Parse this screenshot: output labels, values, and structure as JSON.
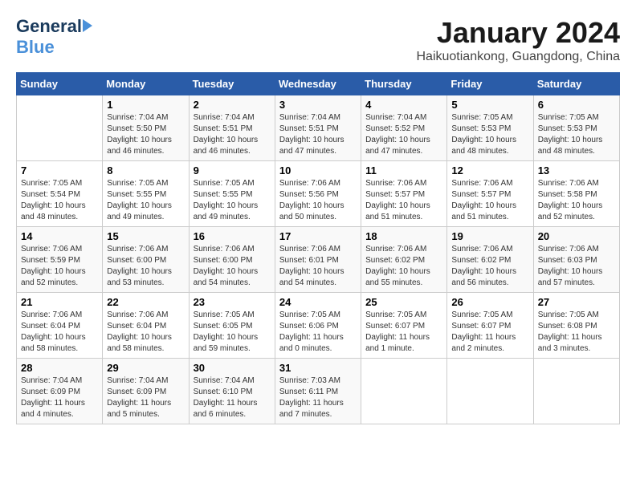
{
  "logo": {
    "part1": "General",
    "part2": "Blue"
  },
  "title": "January 2024",
  "location": "Haikuotiankong, Guangdong, China",
  "headers": [
    "Sunday",
    "Monday",
    "Tuesday",
    "Wednesday",
    "Thursday",
    "Friday",
    "Saturday"
  ],
  "weeks": [
    [
      {
        "day": "",
        "sunrise": "",
        "sunset": "",
        "daylight": ""
      },
      {
        "day": "1",
        "sunrise": "Sunrise: 7:04 AM",
        "sunset": "Sunset: 5:50 PM",
        "daylight": "Daylight: 10 hours and 46 minutes."
      },
      {
        "day": "2",
        "sunrise": "Sunrise: 7:04 AM",
        "sunset": "Sunset: 5:51 PM",
        "daylight": "Daylight: 10 hours and 46 minutes."
      },
      {
        "day": "3",
        "sunrise": "Sunrise: 7:04 AM",
        "sunset": "Sunset: 5:51 PM",
        "daylight": "Daylight: 10 hours and 47 minutes."
      },
      {
        "day": "4",
        "sunrise": "Sunrise: 7:04 AM",
        "sunset": "Sunset: 5:52 PM",
        "daylight": "Daylight: 10 hours and 47 minutes."
      },
      {
        "day": "5",
        "sunrise": "Sunrise: 7:05 AM",
        "sunset": "Sunset: 5:53 PM",
        "daylight": "Daylight: 10 hours and 48 minutes."
      },
      {
        "day": "6",
        "sunrise": "Sunrise: 7:05 AM",
        "sunset": "Sunset: 5:53 PM",
        "daylight": "Daylight: 10 hours and 48 minutes."
      }
    ],
    [
      {
        "day": "7",
        "sunrise": "Sunrise: 7:05 AM",
        "sunset": "Sunset: 5:54 PM",
        "daylight": "Daylight: 10 hours and 48 minutes."
      },
      {
        "day": "8",
        "sunrise": "Sunrise: 7:05 AM",
        "sunset": "Sunset: 5:55 PM",
        "daylight": "Daylight: 10 hours and 49 minutes."
      },
      {
        "day": "9",
        "sunrise": "Sunrise: 7:05 AM",
        "sunset": "Sunset: 5:55 PM",
        "daylight": "Daylight: 10 hours and 49 minutes."
      },
      {
        "day": "10",
        "sunrise": "Sunrise: 7:06 AM",
        "sunset": "Sunset: 5:56 PM",
        "daylight": "Daylight: 10 hours and 50 minutes."
      },
      {
        "day": "11",
        "sunrise": "Sunrise: 7:06 AM",
        "sunset": "Sunset: 5:57 PM",
        "daylight": "Daylight: 10 hours and 51 minutes."
      },
      {
        "day": "12",
        "sunrise": "Sunrise: 7:06 AM",
        "sunset": "Sunset: 5:57 PM",
        "daylight": "Daylight: 10 hours and 51 minutes."
      },
      {
        "day": "13",
        "sunrise": "Sunrise: 7:06 AM",
        "sunset": "Sunset: 5:58 PM",
        "daylight": "Daylight: 10 hours and 52 minutes."
      }
    ],
    [
      {
        "day": "14",
        "sunrise": "Sunrise: 7:06 AM",
        "sunset": "Sunset: 5:59 PM",
        "daylight": "Daylight: 10 hours and 52 minutes."
      },
      {
        "day": "15",
        "sunrise": "Sunrise: 7:06 AM",
        "sunset": "Sunset: 6:00 PM",
        "daylight": "Daylight: 10 hours and 53 minutes."
      },
      {
        "day": "16",
        "sunrise": "Sunrise: 7:06 AM",
        "sunset": "Sunset: 6:00 PM",
        "daylight": "Daylight: 10 hours and 54 minutes."
      },
      {
        "day": "17",
        "sunrise": "Sunrise: 7:06 AM",
        "sunset": "Sunset: 6:01 PM",
        "daylight": "Daylight: 10 hours and 54 minutes."
      },
      {
        "day": "18",
        "sunrise": "Sunrise: 7:06 AM",
        "sunset": "Sunset: 6:02 PM",
        "daylight": "Daylight: 10 hours and 55 minutes."
      },
      {
        "day": "19",
        "sunrise": "Sunrise: 7:06 AM",
        "sunset": "Sunset: 6:02 PM",
        "daylight": "Daylight: 10 hours and 56 minutes."
      },
      {
        "day": "20",
        "sunrise": "Sunrise: 7:06 AM",
        "sunset": "Sunset: 6:03 PM",
        "daylight": "Daylight: 10 hours and 57 minutes."
      }
    ],
    [
      {
        "day": "21",
        "sunrise": "Sunrise: 7:06 AM",
        "sunset": "Sunset: 6:04 PM",
        "daylight": "Daylight: 10 hours and 58 minutes."
      },
      {
        "day": "22",
        "sunrise": "Sunrise: 7:06 AM",
        "sunset": "Sunset: 6:04 PM",
        "daylight": "Daylight: 10 hours and 58 minutes."
      },
      {
        "day": "23",
        "sunrise": "Sunrise: 7:05 AM",
        "sunset": "Sunset: 6:05 PM",
        "daylight": "Daylight: 10 hours and 59 minutes."
      },
      {
        "day": "24",
        "sunrise": "Sunrise: 7:05 AM",
        "sunset": "Sunset: 6:06 PM",
        "daylight": "Daylight: 11 hours and 0 minutes."
      },
      {
        "day": "25",
        "sunrise": "Sunrise: 7:05 AM",
        "sunset": "Sunset: 6:07 PM",
        "daylight": "Daylight: 11 hours and 1 minute."
      },
      {
        "day": "26",
        "sunrise": "Sunrise: 7:05 AM",
        "sunset": "Sunset: 6:07 PM",
        "daylight": "Daylight: 11 hours and 2 minutes."
      },
      {
        "day": "27",
        "sunrise": "Sunrise: 7:05 AM",
        "sunset": "Sunset: 6:08 PM",
        "daylight": "Daylight: 11 hours and 3 minutes."
      }
    ],
    [
      {
        "day": "28",
        "sunrise": "Sunrise: 7:04 AM",
        "sunset": "Sunset: 6:09 PM",
        "daylight": "Daylight: 11 hours and 4 minutes."
      },
      {
        "day": "29",
        "sunrise": "Sunrise: 7:04 AM",
        "sunset": "Sunset: 6:09 PM",
        "daylight": "Daylight: 11 hours and 5 minutes."
      },
      {
        "day": "30",
        "sunrise": "Sunrise: 7:04 AM",
        "sunset": "Sunset: 6:10 PM",
        "daylight": "Daylight: 11 hours and 6 minutes."
      },
      {
        "day": "31",
        "sunrise": "Sunrise: 7:03 AM",
        "sunset": "Sunset: 6:11 PM",
        "daylight": "Daylight: 11 hours and 7 minutes."
      },
      {
        "day": "",
        "sunrise": "",
        "sunset": "",
        "daylight": ""
      },
      {
        "day": "",
        "sunrise": "",
        "sunset": "",
        "daylight": ""
      },
      {
        "day": "",
        "sunrise": "",
        "sunset": "",
        "daylight": ""
      }
    ]
  ]
}
